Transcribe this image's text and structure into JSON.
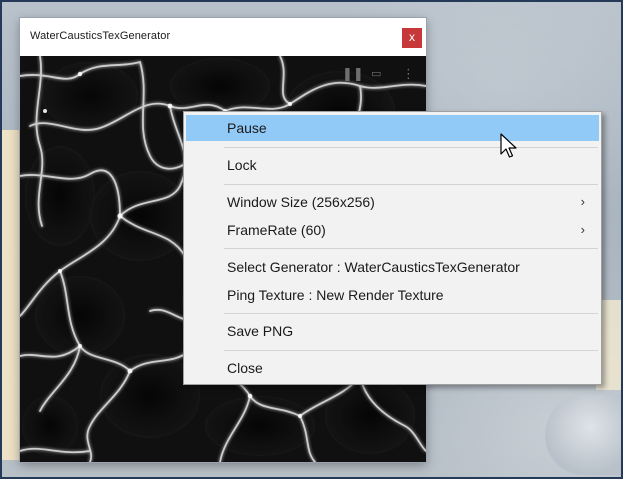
{
  "window": {
    "title": "WaterCausticsTexGenerator",
    "close_label": "x"
  },
  "view_controls": {
    "pause_icon": "pause-icon",
    "window_icon": "window-icon",
    "more_icon": "more-vertical-icon"
  },
  "context_menu": {
    "items": [
      {
        "label": "Pause",
        "highlighted": true
      },
      {
        "label": "Lock"
      },
      {
        "label": "Window Size (256x256)",
        "submenu": true
      },
      {
        "label": "FrameRate (60)",
        "submenu": true
      },
      {
        "label": "Select Generator : WaterCausticsTexGenerator"
      },
      {
        "label": "Ping Texture : New Render Texture"
      },
      {
        "label": "Save PNG"
      },
      {
        "label": "Close"
      }
    ],
    "submenu_arrow": "›"
  },
  "colors": {
    "highlight": "#91c9f7",
    "close_button": "#c8383a",
    "menu_background": "#f2f2f2"
  }
}
